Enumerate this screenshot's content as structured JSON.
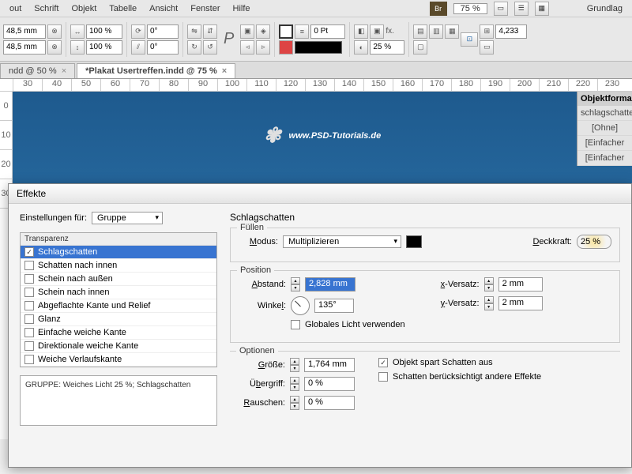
{
  "menubar": {
    "items": [
      "out",
      "Schrift",
      "Objekt",
      "Tabelle",
      "Ansicht",
      "Fenster",
      "Hilfe"
    ],
    "br": "Br",
    "zoom": "75 %",
    "right_label": "Grundlag"
  },
  "toolbar": {
    "x": "48,5 mm",
    "y": "48,5 mm",
    "pct1": "100 %",
    "pct2": "100 %",
    "rot": "0°",
    "shear": "0°",
    "pt": "0 Pt",
    "stroke_pct": "25 %",
    "far_right": "4,233"
  },
  "tabs": [
    {
      "label": "ndd @ 50 %",
      "active": false
    },
    {
      "label": "*Plakat Usertreffen.indd @ 75 %",
      "active": true
    }
  ],
  "ruler": {
    "marks": [
      "30",
      "40",
      "50",
      "60",
      "70",
      "80",
      "90",
      "100",
      "110",
      "120",
      "130",
      "140",
      "150",
      "160",
      "170",
      "180",
      "190",
      "200",
      "210",
      "220",
      "230"
    ],
    "v": [
      "0",
      "10",
      "20",
      "30"
    ]
  },
  "canvas": {
    "text": "www.PSD-Tutorials.de"
  },
  "panel_right": {
    "header": "Objektforma",
    "items": [
      "schlagschatten",
      "[Ohne]",
      "[Einfacher",
      "[Einfacher"
    ]
  },
  "dialog": {
    "title": "Effekte",
    "settings_label": "Einstellungen für:",
    "settings_value": "Gruppe",
    "fx_group": "Transparenz",
    "fx_items": [
      {
        "label": "Schlagschatten",
        "checked": true,
        "selected": true
      },
      {
        "label": "Schatten nach innen",
        "checked": false
      },
      {
        "label": "Schein nach außen",
        "checked": false
      },
      {
        "label": "Schein nach innen",
        "checked": false
      },
      {
        "label": "Abgeflachte Kante und Relief",
        "checked": false
      },
      {
        "label": "Glanz",
        "checked": false
      },
      {
        "label": "Einfache weiche Kante",
        "checked": false
      },
      {
        "label": "Direktionale weiche Kante",
        "checked": false
      },
      {
        "label": "Weiche Verlaufskante",
        "checked": false
      }
    ],
    "summary": "GRUPPE: Weiches Licht 25 %; Schlagschatten",
    "right": {
      "heading": "Schlagschatten",
      "fill_legend": "Füllen",
      "mode_label": "Modus:",
      "mode_value": "Multiplizieren",
      "opacity_label": "Deckkraft:",
      "opacity_value": "25 %",
      "pos_legend": "Position",
      "dist_label": "Abstand:",
      "dist_value": "2,828 mm",
      "angle_label": "Winkel:",
      "angle_value": "135°",
      "global_light": "Globales Licht verwenden",
      "xoff_label": "x-Versatz:",
      "xoff_value": "2 mm",
      "yoff_label": "y-Versatz:",
      "yoff_value": "2 mm",
      "opt_legend": "Optionen",
      "size_label": "Größe:",
      "size_value": "1,764 mm",
      "spread_label": "Übergriff:",
      "spread_value": "0 %",
      "noise_label": "Rauschen:",
      "noise_value": "0 %",
      "knockout": "Objekt spart Schatten aus",
      "other_fx": "Schatten berücksichtigt andere Effekte"
    }
  }
}
